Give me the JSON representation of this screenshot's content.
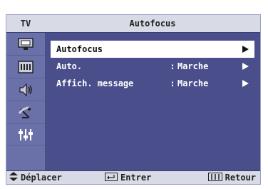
{
  "sidebar": {
    "title": "TV",
    "icons": [
      {
        "name": "picture-icon"
      },
      {
        "name": "sound-icon"
      },
      {
        "name": "channel-icon"
      },
      {
        "name": "speaker-icon"
      },
      {
        "name": "antenna-icon"
      },
      {
        "name": "setup-icon",
        "active": true
      }
    ]
  },
  "header": {
    "title": "Autofocus"
  },
  "menu": {
    "items": [
      {
        "label": "Autofocus",
        "value": "",
        "separator": "",
        "selected": true
      },
      {
        "label": "Auto.",
        "value": "Marche",
        "separator": ":"
      },
      {
        "label": "Affich. message",
        "value": "Marche",
        "separator": ":"
      }
    ]
  },
  "footer": {
    "move_label": "Déplacer",
    "enter_label": "Entrer",
    "back_label": "Retour"
  },
  "colors": {
    "panel": "#4a4f8c",
    "sidebar": "#6a70a8",
    "bar": "#d8dbe6",
    "active_icon": "#1b1e3a",
    "selected_row": "#ffffff"
  }
}
